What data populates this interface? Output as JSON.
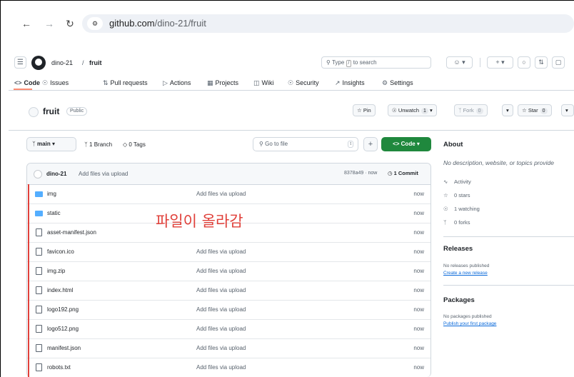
{
  "browser": {
    "url_host": "github.com",
    "url_path": "/dino-21/fruit"
  },
  "header": {
    "owner": "dino-21",
    "separator": "/",
    "repo": "fruit",
    "search_placeholder": "Type",
    "search_key": "/",
    "search_suffix": "to search"
  },
  "tabs": [
    {
      "label": "Code",
      "icon": "code-icon"
    },
    {
      "label": "Issues",
      "icon": "issue-icon"
    },
    {
      "label": "Pull requests",
      "icon": "pull-request-icon"
    },
    {
      "label": "Actions",
      "icon": "play-icon"
    },
    {
      "label": "Projects",
      "icon": "table-icon"
    },
    {
      "label": "Wiki",
      "icon": "book-icon"
    },
    {
      "label": "Security",
      "icon": "shield-icon"
    },
    {
      "label": "Insights",
      "icon": "graph-icon"
    },
    {
      "label": "Settings",
      "icon": "gear-icon"
    }
  ],
  "repo": {
    "name": "fruit",
    "visibility": "Public",
    "pin_label": "Pin",
    "watch_label": "Unwatch",
    "watch_count": "1",
    "fork_label": "Fork",
    "fork_count": "0",
    "star_label": "Star",
    "star_count": "0"
  },
  "file_nav": {
    "branch": "main",
    "branches": "1 Branch",
    "tags": "0 Tags",
    "goto_placeholder": "Go to file",
    "goto_key": "t",
    "code_button": "Code"
  },
  "latest_commit": {
    "user": "dino-21",
    "message": "Add files via upload",
    "hash_time": "8378a49 · now",
    "count": "1 Commit"
  },
  "files": [
    {
      "name": "img",
      "type": "folder",
      "message": "Add files via upload",
      "time": "now"
    },
    {
      "name": "static",
      "type": "folder",
      "message": "",
      "time": "now"
    },
    {
      "name": "asset-manifest.json",
      "type": "file",
      "message": "",
      "time": "now"
    },
    {
      "name": "favicon.ico",
      "type": "file",
      "message": "Add files via upload",
      "time": "now"
    },
    {
      "name": "img.zip",
      "type": "file",
      "message": "Add files via upload",
      "time": "now"
    },
    {
      "name": "index.html",
      "type": "file",
      "message": "Add files via upload",
      "time": "now"
    },
    {
      "name": "logo192.png",
      "type": "file",
      "message": "Add files via upload",
      "time": "now"
    },
    {
      "name": "logo512.png",
      "type": "file",
      "message": "Add files via upload",
      "time": "now"
    },
    {
      "name": "manifest.json",
      "type": "file",
      "message": "Add files via upload",
      "time": "now"
    },
    {
      "name": "robots.txt",
      "type": "file",
      "message": "Add files via upload",
      "time": "now"
    }
  ],
  "annotation": "파일이 올라감",
  "about": {
    "title": "About",
    "description": "No description, website, or topics provide",
    "activity": "Activity",
    "stars": "0 stars",
    "watching": "1 watching",
    "forks": "0 forks"
  },
  "releases": {
    "title": "Releases",
    "none": "No releases published",
    "create_link": "Create a new release"
  },
  "packages": {
    "title": "Packages",
    "none": "No packages published",
    "publish_link": "Publish your first package"
  },
  "colors": {
    "code_button": "#1f883d",
    "annotation": "#e0403a",
    "folder": "#54aeff",
    "link": "#0969da"
  }
}
